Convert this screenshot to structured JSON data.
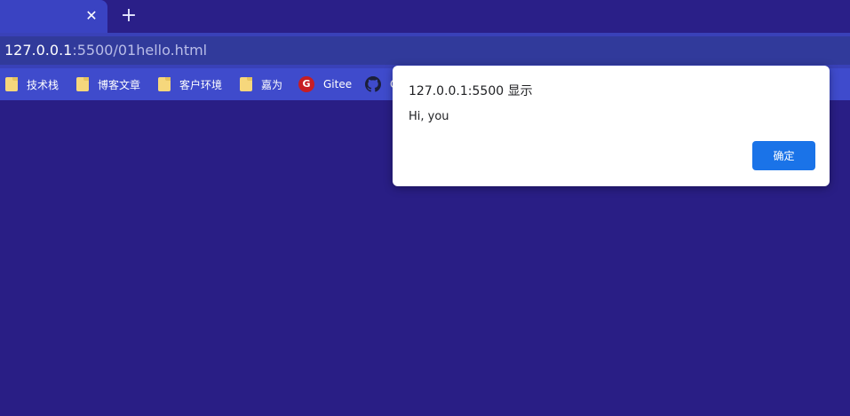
{
  "tab": {
    "close_glyph": "✕"
  },
  "tabbar": {
    "new_tab_glyph": "+"
  },
  "address": {
    "host": "127.0.0.1",
    "path": ":5500/01hello.html"
  },
  "bookmarks": [
    {
      "label": "技术栈",
      "icon": "folder-icon"
    },
    {
      "label": "博客文章",
      "icon": "folder-icon"
    },
    {
      "label": "客户环境",
      "icon": "folder-icon"
    },
    {
      "label": "嘉为",
      "icon": "folder-icon"
    },
    {
      "label": "Gitee",
      "icon": "gitee-icon",
      "glyph": "G"
    },
    {
      "label": "G",
      "icon": "github-icon"
    }
  ],
  "dialog": {
    "title": "127.0.0.1:5500 显示",
    "message": "Hi, you",
    "ok_label": "确定"
  },
  "colors": {
    "page_bg": "#291e85",
    "tab_active": "#3a43c2",
    "bookmark_bar": "#3f4bcc",
    "button_primary": "#1a73e8"
  }
}
